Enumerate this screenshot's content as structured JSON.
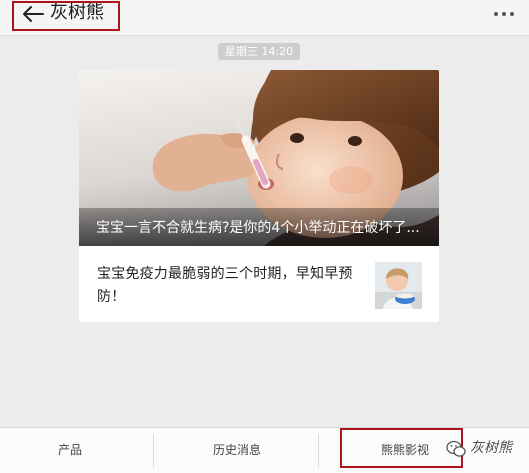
{
  "header": {
    "back_icon": "arrow-left-icon",
    "title": "灰树熊",
    "more_icon": "more-horizontal-icon"
  },
  "timestamp": "星期三 14:20",
  "article_card": {
    "cover_article": {
      "title": "宝宝一言不合就生病?是你的4个小举动正在破坏了..."
    },
    "list_articles": [
      {
        "title": "宝宝免疫力最脆弱的三个时期，早知早预防！"
      }
    ]
  },
  "menu": {
    "items": [
      {
        "label": "产品"
      },
      {
        "label": "历史消息"
      },
      {
        "label": "熊熊影视"
      }
    ]
  },
  "watermark": {
    "icon": "wechat-icon",
    "text": "灰树熊"
  },
  "colors": {
    "highlight_border": "#a8161c",
    "timestamp_background": "#cdcdcd",
    "page_background": "#ececec",
    "menu_background": "#fbfbfb"
  }
}
